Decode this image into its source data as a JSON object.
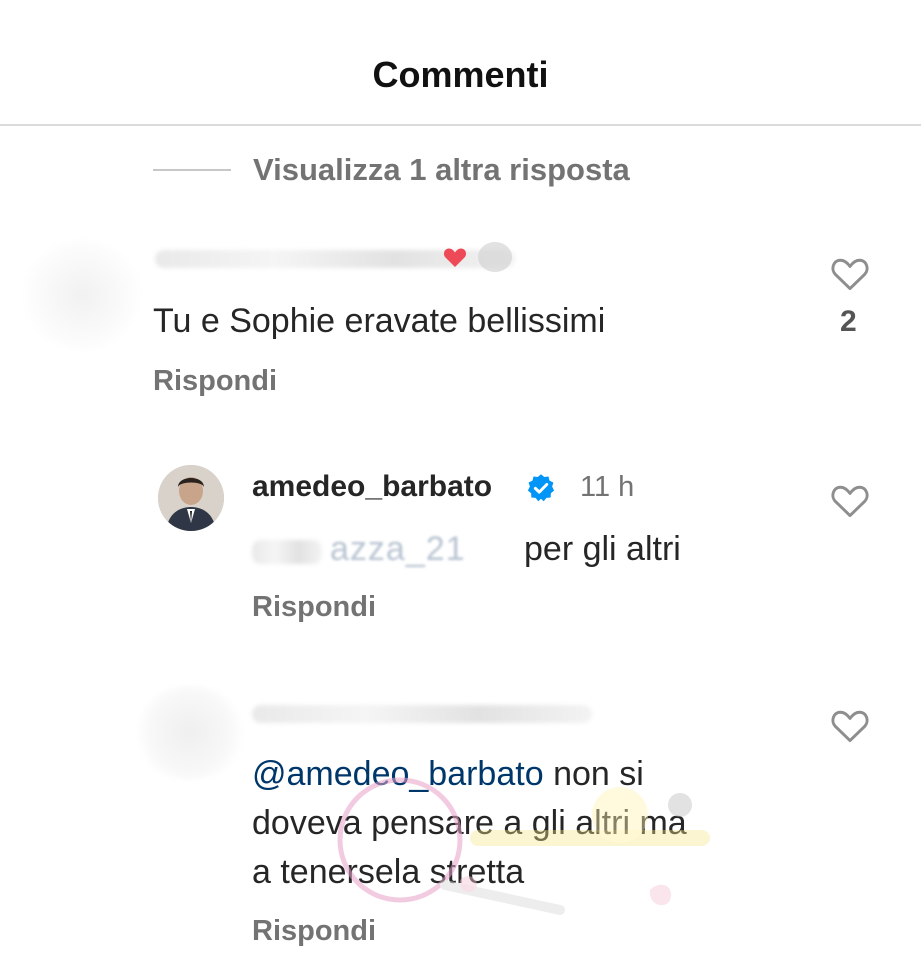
{
  "header": {
    "title": "Commenti"
  },
  "thread": {
    "view_more": "Visualizza 1 altra risposta"
  },
  "comments": [
    {
      "username": "",
      "text": "Tu e Sophie eravate bellissimi",
      "reply": "Rispondi",
      "likes": "2"
    },
    {
      "username": "amedeo_barbato",
      "time": "11 h",
      "mention": "azza_21",
      "text": "per gli altri",
      "reply": "Rispondi"
    },
    {
      "username": "",
      "mention": "@amedeo_barbato",
      "text_lines": [
        "non si",
        "doveva pensare a gli altri ma",
        "a tenersela stretta"
      ],
      "reply": "Rispondi"
    }
  ],
  "icons": {
    "like": "heart-outline-icon",
    "verified": "verified-badge-icon"
  },
  "colors": {
    "mention": "#00376b",
    "verified": "#0095f6",
    "secondary": "#737373"
  }
}
